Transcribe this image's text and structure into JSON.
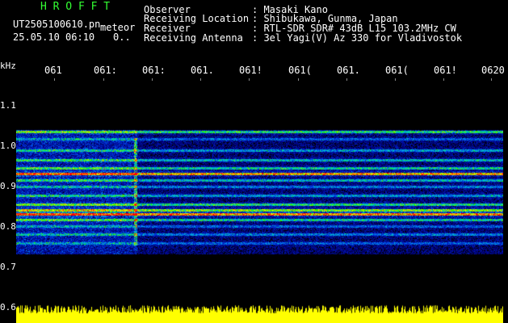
{
  "header": {
    "app_name": "H R O F F T",
    "filename": "UT2505100610.pn",
    "type_label": "meteor",
    "datetime": "25.05.10 06:10",
    "count": "0..",
    "fields": [
      {
        "label": "Observer",
        "value": ": Masaki Kano"
      },
      {
        "label": "Receiving Location",
        "value": ": Shibukawa, Gunma, Japan"
      },
      {
        "label": "Receiver",
        "value": ": RTL-SDR SDR# 43dB L15 103.2MHz CW"
      },
      {
        "label": "Receiving Antenna",
        "value": ": 3el Yagi(V) Az 330 for Vladivostok"
      }
    ]
  },
  "axis": {
    "unit": "kHz",
    "time_ticks": [
      "061",
      "061:",
      "061:",
      "061.",
      "061!",
      "061(",
      "061.",
      "061(",
      "061!",
      "0620"
    ],
    "freq_ticks": [
      "1.1",
      "1.0",
      "0.9",
      "0.8",
      "0.7",
      "0.6"
    ]
  },
  "colors": {
    "background": "#000000",
    "title_green": "#33ff33",
    "noise_floor": "#0a1a8a",
    "signal_strong": "#ff2020",
    "amplitude_yellow": "#ffff00"
  }
}
